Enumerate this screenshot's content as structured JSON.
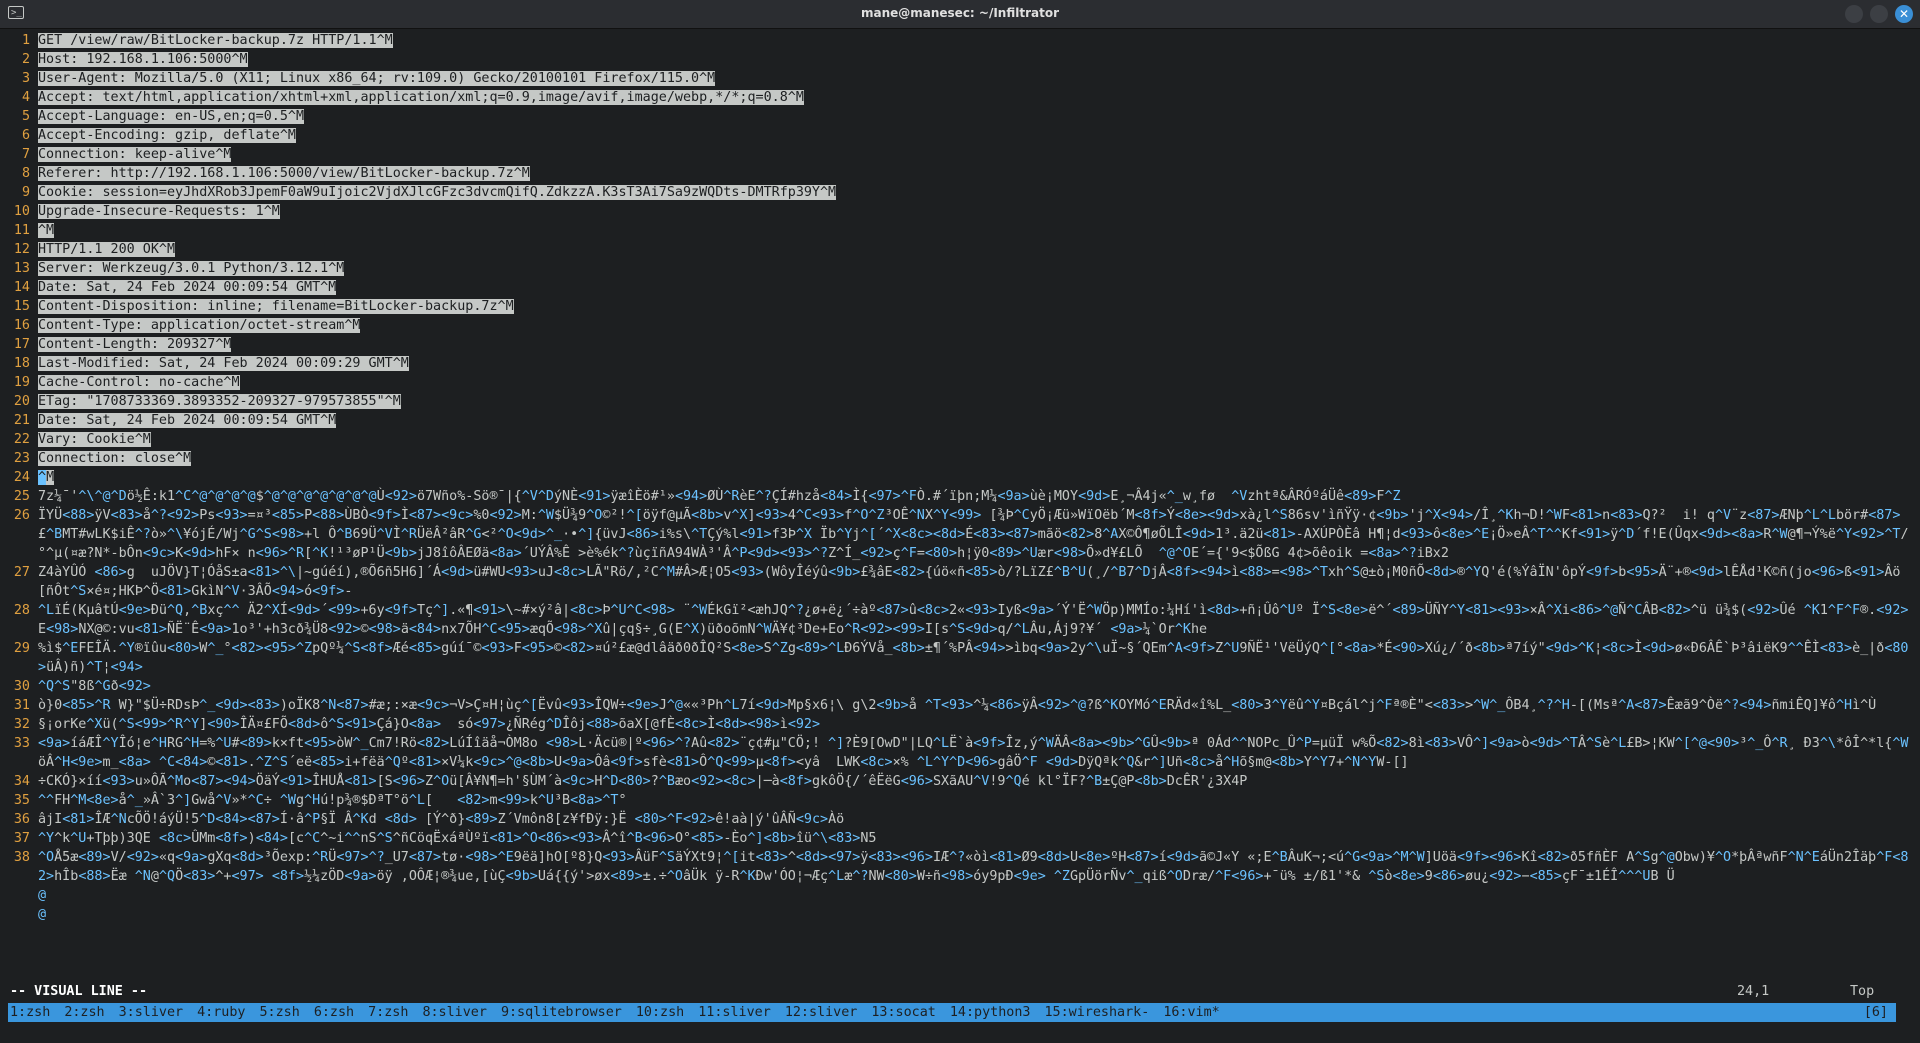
{
  "window": {
    "title": "mane@manesec: ~/Infiltrator",
    "terminal_icon": "terminal-icon",
    "buttons": [
      "minimize-button",
      "maximize-button",
      "close-button"
    ],
    "close_glyph": "✕"
  },
  "editor": {
    "selected_lines": [
      "GET /view/raw/BitLocker-backup.7z HTTP/1.1^M",
      "Host: 192.168.1.106:5000^M",
      "User-Agent: Mozilla/5.0 (X11; Linux x86_64; rv:109.0) Gecko/20100101 Firefox/115.0^M",
      "Accept: text/html,application/xhtml+xml,application/xml;q=0.9,image/avif,image/webp,*/*;q=0.8^M",
      "Accept-Language: en-US,en;q=0.5^M",
      "Accept-Encoding: gzip, deflate^M",
      "Connection: keep-alive^M",
      "Referer: http://192.168.1.106:5000/view/BitLocker-backup.7z^M",
      "Cookie: session=eyJhdXRob3JpemF0aW9uIjoic2VjdXJlcGFzc3dvcmQifQ.ZdkzzA.K3sT3Ai7Sa9zWQDts-DMTRfp39Y^M",
      "Upgrade-Insecure-Requests: 1^M",
      "^M",
      "HTTP/1.1 200 OK^M",
      "Server: Werkzeug/3.0.1 Python/3.12.1^M",
      "Date: Sat, 24 Feb 2024 00:09:54 GMT^M",
      "Content-Disposition: inline; filename=BitLocker-backup.7z^M",
      "Content-Type: application/octet-stream^M",
      "Content-Length: 209327^M",
      "Last-Modified: Sat, 24 Feb 2024 00:09:29 GMT^M",
      "Cache-Control: no-cache^M",
      "ETag: \"1708733369.3893352-209327-979573855\"^M",
      "Date: Sat, 24 Feb 2024 00:09:54 GMT^M",
      "Vary: Cookie^M",
      "Connection: close^M"
    ],
    "cursor_line": {
      "num": "24",
      "cursor_text": "^",
      "rest": "M"
    },
    "binary_lines": [
      {
        "num": "25",
        "text": "7z¼¯'^\\^@^Dö½Ê:k1^C^@^@^@^@$^@^@^@^@^@^@^@Ù<92>ö7Wño%-Sö®¯|{^V^DýNÈ<91>ÿæîÈö#¹»<94>ØÙ^RèE^?ÇÍ#hzå<84>Ì{<97>^FÒ.#´ïþn;M¼<9a>ùè¡MOY<9d>E¸¬Â4j«^_w¸fø  ^Vzhtª&ÂRÓºáÜê<89>F^Z"
      },
      {
        "num": "26",
        "text": "ÏYÜ<88>ÿV<83>å^?<92>Ps<93>=¤³<85>P<88>ÙBÒ<9f>Ì<87><9c>%0<92>M:^W$Ü¾9^O©²!^[öÿf@µÃ<8b>v^X]<93>4^C<93>f^O^Z³OÊ^NX^Y<99> [¾Þ^CyÖ¡Æü»WïOëb´M<8f>Ý<8e><9d>xà¿l^S86sv'ìñŸÿ·¢<9b>'j^X<94>/Î¸^Kh¬D!^WF<81>n<83>Q?²  i! q^V¨z<87>ÆNþ^L^Lbör#<87>£^BMT#wLK$iÊ^?ò»^\\¥ójÉ/Wj^G^S<98>+l Ô^B69Ü^VÌ^RÜëÂ²âR^G<²^O<9d>^_·•^]{üvJ<86>i%s\\^TÇý%l<91>f3Þ^X Ïb^Yj^[´^X<8c><8d>É<83><87>mãö<82>8^AX©Ô¶øÕLÎ<9d>1³.ä2ü<81>-AXÚPÒÈâ H¶¦d<93>ô<8e>^E¡Ö»eÂ^T^^Kf<91>ÿ^D´f!E(Ûqx<9d><8a>R^W@¶¬Ý%ë^Y<92>^T/°^µ(¤æ?N*-bÔn<9c>K<9d>hF× n<96>^R[^K!¹³øP¹Ü<9b>jJ8îôÂEØä<8a>´UÝÂ%Ê >è%ék^?ùçïñA94WÀ³'Â^P<9d><93>^?Z^Í_<92>ç^F=<80>h¦ÿ0<89>^Uær<98>Õ»d¥£LÕ  ^@^OE´={'9<$ÕßG 4¢>õêoik =<8a>^?iBx2"
      },
      {
        "num": "27",
        "text": "Z4àYÛÓ <86>g  uJÖV}T¦ÓåS±a<81>^\\|~gúéí),®Õ6ñ5H6]´Á<9d>ü#WU<93>uJ<8c>LÃ\"Rö/,²C^M#Â>Æ¦O5<93>(WôyÎéýû<9b>£¾âE<82>{úö«ñ<85>ò/?LïZ£^B^U(¸/^B7^DjÂ<8f><94>ì<88>=<98>^Txh^S@±ò¡M0ñÕ<8d>®^YQ'é(%ÝâÏN'ôpÝ<9f>b<95>Ä¨+®<9d>lÊÅd¹K©ñ(jo<96>ß<91>Âö[ñÔt^S×é¤;HKÞ^Ö<81>GkìN^V·3ÂÕ<94>ó<9f>-"
      },
      {
        "num": "28",
        "text": "^LïÉ(KµâtÚ<9e>Ðü^Q,^Bxç^^ Ä2^XÍ<9d>´<99>+6y<9f>Tç^].«¶<91>\\~#×ý²â|<8c>Þ^U^C<98> ¨^WÉkGï²<æhJQ^?¿ø+ë¿´÷àº<87>û<8c>2«<93>Iyß<9a>´Ý'Ë^WÖp)MMÍo:¼Hí'ì<8d>+ñ¡Ûô^Uº Ï^S<8e>ë^´<89>ÜÑY^Y<81><93>×Â^Xi<86>^@Ñ^CÂB<82>^ü ü¾$(<92>Ûé ^K1^F^F®.<92>E<98>NX@©:vu<81>ÑË¨Ê<9a>1o³'+h3cð¾Ü8<92>©<98>ä<84>nx7ÕH^C<95>æqÕ<98>^Xû|çq§÷¸G(E^X)üðoõmN^WÄ¥¢³De+Eo^R<92><99>I[s^S<9d>q/^LÂu,Áj9?¥´ <9a>¼`Or^Khe"
      },
      {
        "num": "29",
        "text": "%ì$^EFEÎÄ.^Y®ïûu<80>W^_°<82><95>^ZpQº¼^S<8f>Æé<85>gúí¯©<93>F<95>©<82>¤ú²£æ@dlâäð0ðÎQ²S<8e>S^Zg<89>^LÐ6ÝVå_<8b>±¶´%PÂ<94>>ìbq<9a>2y^\\uÏ~§´QEm^A<9f>Z^U9ÑË¹'VëÜýQ^[°<8a>*É<90>Xú¿/´ð<8b>ª7íý\"<9d>^K¦<8c>Ì<9d>ø«Ð6ÂÊ`Þ³âiëK9^^ÊÌ<83>è_|ð<80>üÂ)ñ)^T¦<94>"
      },
      {
        "num": "30",
        "text": "^Q^S\"8ß^Gð<92>"
      },
      {
        "num": "31",
        "text": "ò}0<85>^R W}\"$Ü÷RDsÞ^_<9d><83>)oÏK8^N<87>#æ;:×æ<9c>¬V>Ç¤H¦ùç^[Ëvû<93>ÎQW÷<9e>J^@««³Ph^L7í<9d>Mp§x6¦\\ g\\2<9b>å ^T<93>^¼<86>ÿÂ<92>^@?ß^KOYMó^ERÄd«î%L_<80>3^Yëû^Y¤Bçál^j^Fª®È\"<<83>>^W^_ÔB4¸^?^H-[(Msª^A<87>Êæã9^Òë^?<94>ñmiÊQ]¥ô^Hì^Ù"
      },
      {
        "num": "32",
        "text": "§¡orKe^Xü(^S<99>^R^Y]<90>ÎÄ¤£FÕ<8d>ô^S<91>Çá}O<8a>  só<97>¿ÑRég^DÎôj<88>õaX[@fÈ<8c>Ì<8d><98>ì<92>"
      },
      {
        "num": "33",
        "text": "<9a>íáÆÎ^YÎó¦e^HRG^H=%^U#<89>k×ft<95>òW^_Cm7!Rö<82>LúÍîäå¬ÒM8o <98>L·Äcü®|º<96>^?Aû<82>¨ç¢#µ\"CÖ;! ^]?È9[OwD\"|LQ^LË`à<9f>Îz,ý^WÄÂ<8a><9b>^GÛ<9b>ª 0Ád^^NOPc_Û^P=µüÏ w%Õ<82>8ì<83>VÔ^]<9a>ò<9d>^TÂ^Sè^L£B>¦KW^[^@<90>³^_Ô^R¸ Ð3^\\*ôÎ^*l{^WöÂ^H<9e>m_<8a> ^C<84>©<81>.^Z^S´eë<85>i+fëä^Qº<81>×V¼k<9c>^@<8b>U<9a>Ôâ<9f>sfè<81>Ô^Q<99>µ<8f><yâ  LWK<8c>×% ^L^Y^D<96>gâÖ^F <9d>DÿQªk^Q&r^]Uñ<8c>å^Hõ§m@<8b>Y^Y7+^N^YW-[]"
      },
      {
        "num": "34",
        "text": "÷CKÓ}×íí<93>u»ÔÃ^Mo<87><94>ÖäÝ<91>ÎHUÅ<81>[S<96>Z^Oü[Â¥N¶=h'§ÙM´à<9c>H^D<80>?^Bæo<92><8c>|─à<8f>gkôÖ{/´êËëG<96>SXãAU^V!9^Qé kl°ÏF?^B±Ç@P<8b>DcÊR'¿3X4P"
      },
      {
        "num": "35",
        "text": "^^FH^M<8e>å^_»Â`3^]Gwå^V»*^C÷ ^Wg^Hú!p¾®$ÐªT°ö^L[   <82>m<99>k^U³B<8a>^T°"
      },
      {
        "num": "36",
        "text": "âjI<81>ÎÆ^NcÕÖ!áýÜ!5^D<84><87>Í·â^P§Ï Â^Kd <8d> [Ý^ð}<89>Z´Vmôn8[z¥fÐÿ:}Ë <80>^F<92>ê!aà|ý'ûÂÑ<9c>Àö"
      },
      {
        "num": "37",
        "text": "^Y^k^U+Tþþ)3QE <8c>ÛMm<8f>)<84>[c^C^~i^^nS^S^ñCöqËxáªÙºï<81>^O<86><93>Â^î^B<96>O°<85>-Èo^]<8b>îü^\\<83>N5"
      },
      {
        "num": "38",
        "text": "^OÅ5æ<89>V/<92>«q<9a>gXq<8d>³Õexp:^RÜ<97>^?_U7<87>tø·<98>^E9ëä]hO[º8}Q<93>ÂüF^SäÝXt9¦^[it<83>^<8d><97>ÿ<83><96>IÆ^?«òì<81>Ø9<8d>U<8e>ºH<87>í<9d>ã©J«Y «;E^BÂuK¬;<ú^G<9a>^M^W]Uöä<9f><96>Kî<82>ð5fñÈF A^Sg^@Obw)¥^O*þÂªwñF^N^EáÜn2Îäþ^F<82>hÎb<88>Ëæ ^N@^QÖ<83>^+<97> <8f>½¼zÖD<9a>öÿ ,OÔÆ¦®¾ue,[ùÇ<9b>Uá{{ý'>øx<89>±.÷^OâÜk ÿ-R^KÐw'ÓO¦¬Æç^Læ^?NW<80>W÷ñ<98>óy9pÐ<9e> ^ZGpÜörÑv^_qiß^ODræ/^F<96>+¯ü% ±/ß1'*& ^Sò<8e>9<86>øu¿<92>−<85>çF¯±1ÉÎ^^^UB Ü"
      }
    ],
    "empty_marker": "@"
  },
  "status": {
    "mode": "-- VISUAL LINE --",
    "position": "24,1",
    "scroll": "Top"
  },
  "tmux": {
    "windows": [
      "1:zsh",
      "2:zsh",
      "3:sliver",
      "4:ruby",
      "5:zsh",
      "6:zsh",
      "7:zsh",
      "8:sliver",
      "9:sqlitebrowser",
      "10:zsh",
      "11:sliver",
      "12:sliver",
      "13:socat",
      "14:python3",
      "15:wireshark-",
      "16:vim*"
    ],
    "right": "[6]"
  },
  "colors": {
    "background": "#1d1f21",
    "line_number": "#e0a040",
    "selection": "#c5c8c6",
    "special": "#6bc2ff",
    "tmux_bar": "#3a96dd"
  }
}
